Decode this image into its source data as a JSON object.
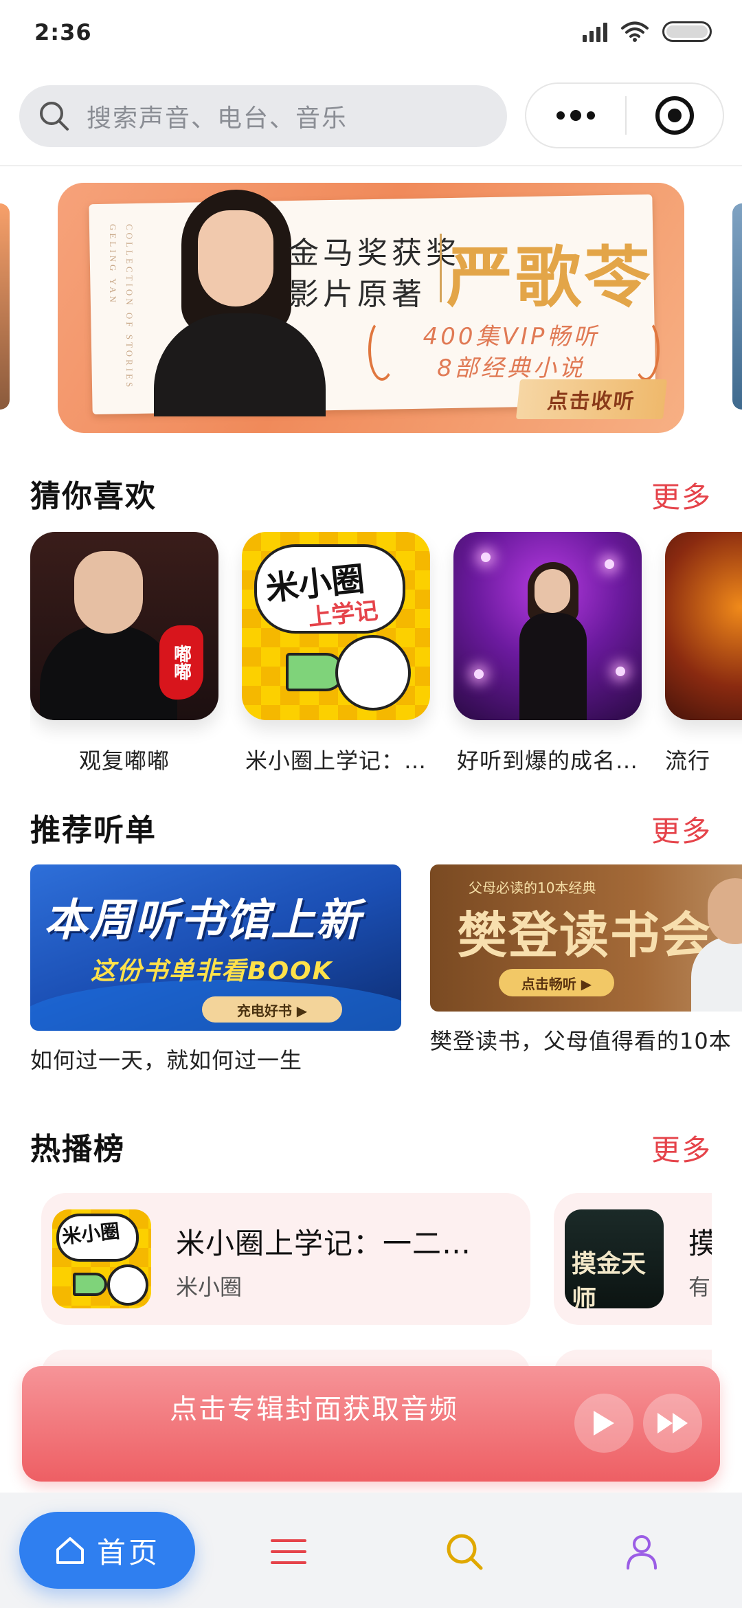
{
  "status_bar": {
    "time": "2:36"
  },
  "search": {
    "placeholder": "搜索声音、电台、音乐"
  },
  "banner": {
    "vertical_text_1": "GELING YAN",
    "vertical_text_2": "COLLECTION OF STORIES",
    "line1": "金马奖获奖",
    "line2": "影片原著",
    "author": "严歌苓",
    "promo_line1": "400集VIP畅听",
    "promo_line2": "8部经典小说",
    "cta": "点击收听"
  },
  "guess_you_like": {
    "title": "猜你喜欢",
    "more": "更多",
    "items": [
      {
        "title": "观复嘟嘟",
        "stamp": "嘟嘟"
      },
      {
        "title": "米小圈上学记：…",
        "cover_text": "米小圈",
        "cover_sub": "上学记"
      },
      {
        "title": "好听到爆的成名…"
      },
      {
        "title": "流行"
      }
    ]
  },
  "recommended_playlists": {
    "title": "推荐听单",
    "more": "更多",
    "items": [
      {
        "title": "如何过一天，就如何过一生",
        "cover_line1": "本周听书馆上新",
        "cover_line2": "这份书单非看BOOK",
        "cover_tag": "充电好书 ▶"
      },
      {
        "title": "樊登读书，父母值得看的10本",
        "cover_top": "父母必读的10本经典",
        "cover_big": "樊登读书会",
        "cover_btn": "点击畅听 ▶"
      }
    ]
  },
  "hot_list": {
    "title": "热播榜",
    "more": "更多",
    "items": [
      {
        "title": "米小圈上学记：一二…",
        "subtitle": "米小圈",
        "cover_text": "米小圈"
      },
      {
        "title": "摸",
        "subtitle": "有",
        "cover_text": "摸金天师"
      }
    ]
  },
  "player": {
    "message": "点击专辑封面获取音频"
  },
  "bottom_nav": {
    "home_label": "首页"
  },
  "colors": {
    "accent_red": "#e5434a",
    "nav_blue": "#2f7ff0",
    "player_gradient": [
      "#f69498",
      "#ee5f64"
    ],
    "search_icon": "#e0a800",
    "user_icon": "#9b5de5",
    "menu_icon": "#e5434a"
  }
}
